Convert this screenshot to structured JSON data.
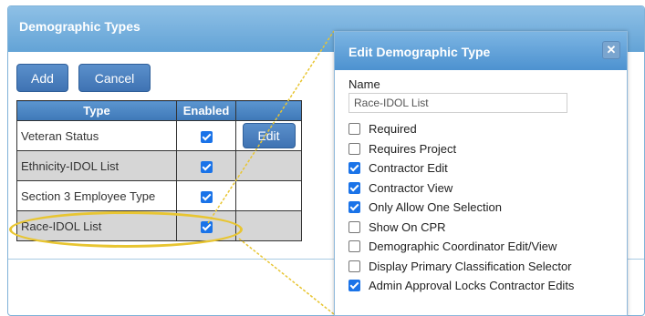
{
  "panel": {
    "title": "Demographic Types",
    "add_label": "Add",
    "cancel_label": "Cancel"
  },
  "table": {
    "headers": [
      "Type",
      "Enabled",
      ""
    ],
    "rows": [
      {
        "type": "Veteran Status",
        "enabled": true,
        "action": "Edit"
      },
      {
        "type": "Ethnicity-IDOL List",
        "enabled": true,
        "action": ""
      },
      {
        "type": "Section 3 Employee Type",
        "enabled": true,
        "action": ""
      },
      {
        "type": "Race-IDOL List",
        "enabled": true,
        "action": ""
      }
    ]
  },
  "dialog": {
    "title": "Edit Demographic Type",
    "close_icon": "close-icon",
    "name_label": "Name",
    "name_value": "Race-IDOL List",
    "options": [
      {
        "label": "Required",
        "checked": false
      },
      {
        "label": "Requires Project",
        "checked": false
      },
      {
        "label": "Contractor Edit",
        "checked": true
      },
      {
        "label": "Contractor View",
        "checked": true
      },
      {
        "label": "Only Allow One Selection",
        "checked": true
      },
      {
        "label": "Show On CPR",
        "checked": false
      },
      {
        "label": "Demographic Coordinator Edit/View",
        "checked": false
      },
      {
        "label": "Display Primary Classification Selector",
        "checked": false
      },
      {
        "label": "Admin Approval Locks Contractor Edits",
        "checked": true
      }
    ]
  },
  "colors": {
    "header_blue": "#63a3d6",
    "button_blue": "#3f73b3",
    "highlight_yellow": "#e8c531",
    "checkbox_blue": "#1a73e8"
  }
}
